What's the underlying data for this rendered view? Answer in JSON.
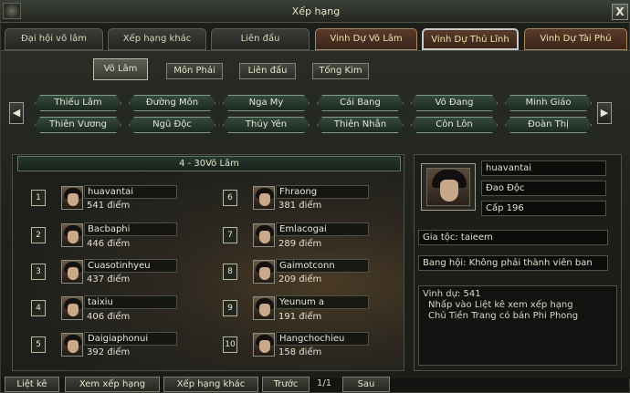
{
  "window": {
    "title": "Xếp hạng",
    "close": "X"
  },
  "main_tabs": [
    {
      "label": "Đại hội võ lâm"
    },
    {
      "label": "Xếp hạng khác"
    },
    {
      "label": "Liên đấu"
    },
    {
      "label": "Vinh Dự Võ Lâm"
    },
    {
      "label": "Vinh Dự Thủ Lĩnh"
    },
    {
      "label": "Vinh Dự Tài Phú"
    }
  ],
  "sub_tabs": [
    {
      "label": "Võ Lâm"
    },
    {
      "label": "Môn Phái"
    },
    {
      "label": "Liên đấu"
    },
    {
      "label": "Tống Kim"
    }
  ],
  "arrows": {
    "left": "◀",
    "right": "▶"
  },
  "sects_row1": [
    "Thiếu Lâm",
    "Đường Môn",
    "Nga My",
    "Cái Bang",
    "Võ Đang",
    "Minh Giáo"
  ],
  "sects_row2": [
    "Thiên Vương",
    "Ngũ Độc",
    "Thúy Yên",
    "Thiên Nhẫn",
    "Côn Lôn",
    "Đoàn Thị"
  ],
  "list": {
    "header": "4 - 30Võ Lâm",
    "entries": [
      {
        "rank": "1",
        "name": "huavantai",
        "score": "541 điểm"
      },
      {
        "rank": "2",
        "name": "Bacbaphi",
        "score": "446 điểm"
      },
      {
        "rank": "3",
        "name": "Cuasotinhyeu",
        "score": "437 điểm"
      },
      {
        "rank": "4",
        "name": "taixiu",
        "score": "406 điểm"
      },
      {
        "rank": "5",
        "name": "Daigiaphonui",
        "score": "392 điểm"
      },
      {
        "rank": "6",
        "name": "Fhraong",
        "score": "381 điểm"
      },
      {
        "rank": "7",
        "name": "Emlacogai",
        "score": "289 điểm"
      },
      {
        "rank": "8",
        "name": "Gaimotconn",
        "score": "209 điểm"
      },
      {
        "rank": "9",
        "name": "Yeunum a",
        "score": "191 điểm"
      },
      {
        "rank": "10",
        "name": "Hangchochieu",
        "score": "158 điểm"
      }
    ]
  },
  "info": {
    "name": "huavantai",
    "school": "Đao Độc",
    "level": "Cấp 196",
    "family": "Gia tộc: taieem",
    "guild": "Bang hội: Không phải thành viên ban",
    "desc": [
      "Vinh dự: 541",
      "Nhấp vào Liệt kê xem xếp hạng",
      "Chủ Tiền Trang có bán Phi Phong"
    ]
  },
  "bottom": {
    "list": "Liệt kê",
    "view": "Xem xếp hạng",
    "other": "Xếp hạng khác",
    "prev": "Trước",
    "page": "1/1",
    "next": "Sau"
  }
}
